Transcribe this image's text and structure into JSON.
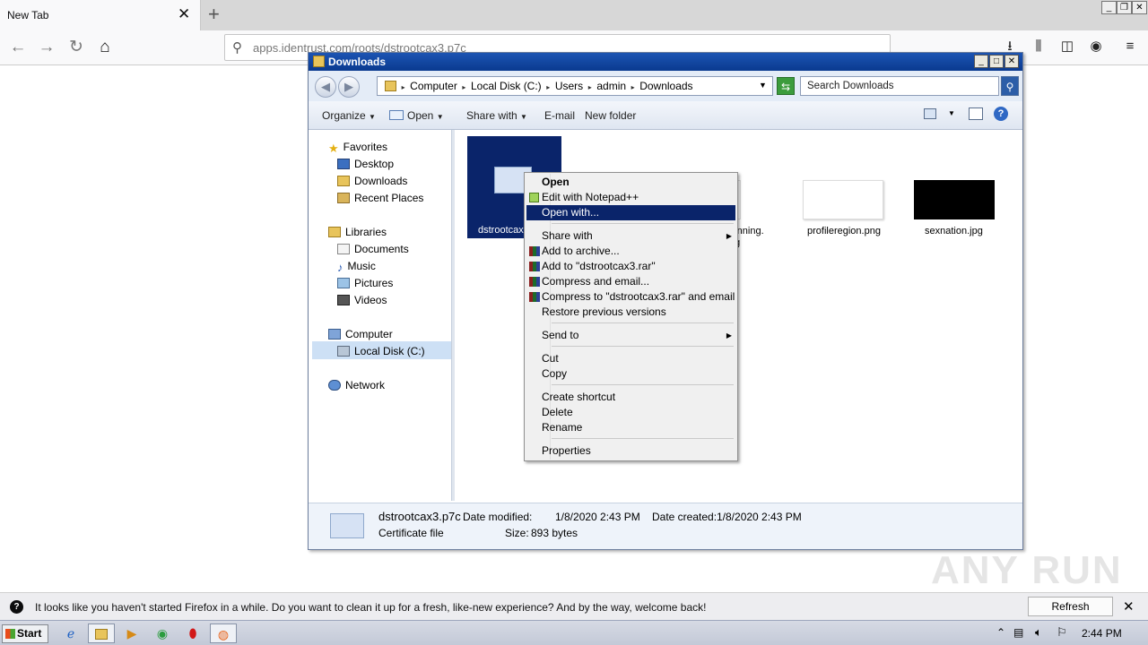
{
  "browser": {
    "tab_title": "New Tab",
    "url": "apps.identrust.com/roots/dstrootcax3.p7c",
    "notification": "It looks like you haven't started Firefox in a while. Do you want to clean it up for a fresh, like-new experience? And by the way, welcome back!",
    "notification_button": "Refresh Firefox…"
  },
  "explorer": {
    "title": "Downloads",
    "breadcrumbs": [
      "Computer",
      "Local Disk (C:)",
      "Users",
      "admin",
      "Downloads"
    ],
    "search_placeholder": "Search Downloads",
    "toolbar": {
      "organize": "Organize",
      "open": "Open",
      "share": "Share with",
      "email": "E-mail",
      "newfolder": "New folder"
    },
    "nav": {
      "favorites": "Favorites",
      "desktop": "Desktop",
      "downloads": "Downloads",
      "recent": "Recent Places",
      "libraries": "Libraries",
      "documents": "Documents",
      "music": "Music",
      "pictures": "Pictures",
      "videos": "Videos",
      "computer": "Computer",
      "localdisk": "Local Disk (C:)",
      "network": "Network"
    },
    "files": [
      "dstrootcax3.p7c",
      "beginning.png",
      "profileregion.png",
      "sexnation.jpg"
    ],
    "selected_label": "dstrootcax",
    "partial_label": "eginning.",
    "partial_label2": "g",
    "status": {
      "name": "dstrootcax3.p7c",
      "type": "Certificate file",
      "modified_label": "Date modified:",
      "modified": "1/8/2020 2:43 PM",
      "created_label": "Date created:",
      "created": "1/8/2020 2:43 PM",
      "size_label": "Size:",
      "size": "893 bytes"
    }
  },
  "context_menu": {
    "open": "Open",
    "notepad": "Edit with Notepad++",
    "openwith": "Open with...",
    "share": "Share with",
    "archive": "Add to archive...",
    "addrar": "Add to \"dstrootcax3.rar\"",
    "compress": "Compress and email...",
    "compressrar": "Compress to \"dstrootcax3.rar\" and email",
    "restore": "Restore previous versions",
    "sendto": "Send to",
    "cut": "Cut",
    "copy": "Copy",
    "shortcut": "Create shortcut",
    "delete": "Delete",
    "rename": "Rename",
    "properties": "Properties"
  },
  "taskbar": {
    "start": "Start",
    "clock": "2:44 PM"
  },
  "watermark": "ANY RUN",
  "colors": {
    "selection": "#0a246a",
    "title": "#0a3a8f"
  }
}
